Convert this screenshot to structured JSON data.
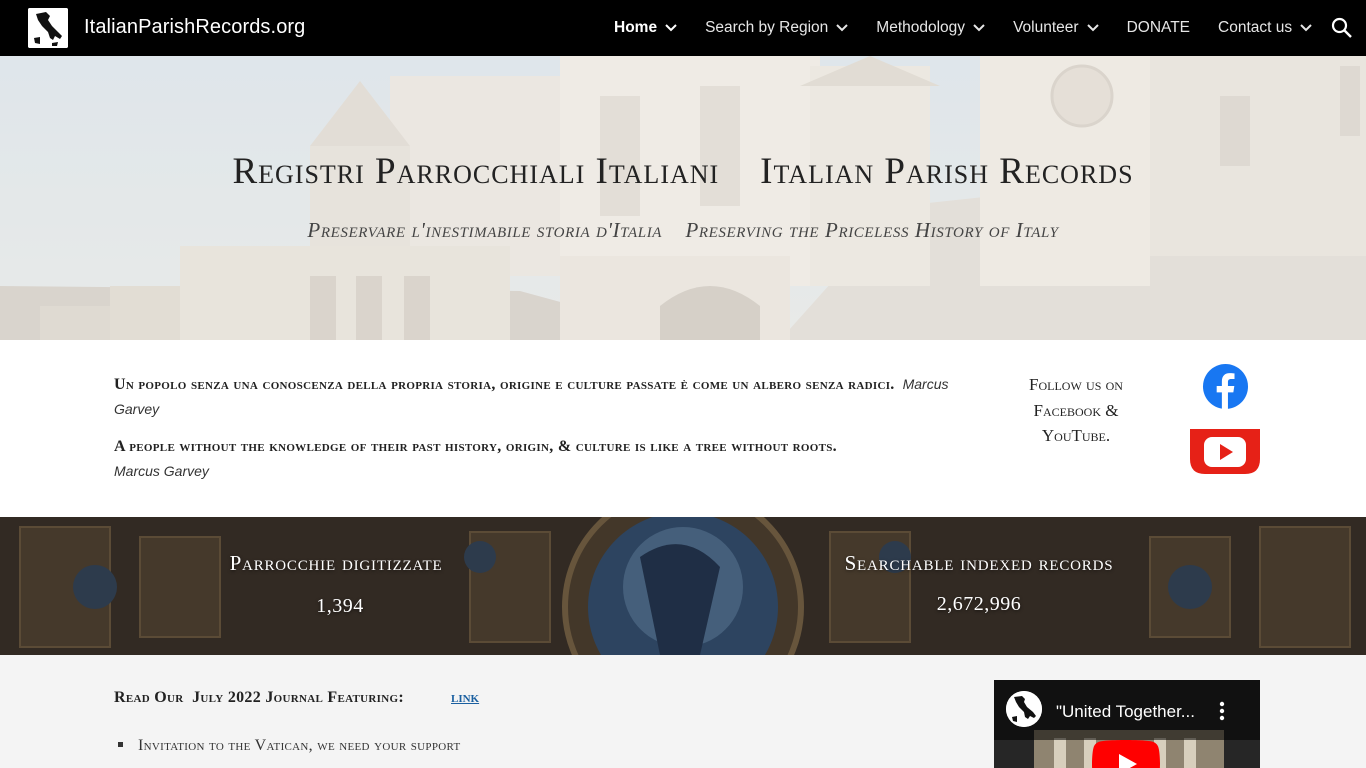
{
  "header": {
    "site_title": "ItalianParishRecords.org",
    "nav": [
      {
        "label": "Home",
        "active": true,
        "has_dropdown": true
      },
      {
        "label": "Search by Region",
        "active": false,
        "has_dropdown": true
      },
      {
        "label": "Methodology",
        "active": false,
        "has_dropdown": true
      },
      {
        "label": "Volunteer",
        "active": false,
        "has_dropdown": true
      },
      {
        "label": "DONATE",
        "active": false,
        "has_dropdown": false
      },
      {
        "label": "Contact us",
        "active": false,
        "has_dropdown": true
      }
    ],
    "search_icon": "search-icon"
  },
  "hero": {
    "title": "Registri Parrocchiali Italiani    Italian Parish Records",
    "subtitle": "Preservare l'inestimabile storia d'Italia    Preserving the Priceless History of Italy"
  },
  "quotes": [
    {
      "text": "Un popolo senza una conoscenza della propria storia, origine e culture passate è come un albero senza radici.",
      "author": "Marcus Garvey"
    },
    {
      "text": "A people without the knowledge of their past history, origin, & culture is like a tree without roots.",
      "author": "Marcus Garvey"
    }
  ],
  "social": {
    "follow_text": "Follow us on Facebook & YouTube.",
    "icons": [
      "facebook-icon",
      "youtube-icon"
    ],
    "colors": {
      "facebook": "#1877f2",
      "youtube": "#e62117"
    }
  },
  "stats": [
    {
      "label": "Parrocchie digitizzate",
      "value": "1,394"
    },
    {
      "label": "Searchable indexed records",
      "value": "2,672,996"
    }
  ],
  "journal": {
    "heading": "Read Our  July 2022 Journal Featuring:",
    "link_label": "link",
    "items": [
      "Invitation to the Vatican, we need your support"
    ]
  },
  "video": {
    "title": "\"United Together...",
    "icons": [
      "video-menu-icon",
      "youtube-play-icon"
    ]
  }
}
